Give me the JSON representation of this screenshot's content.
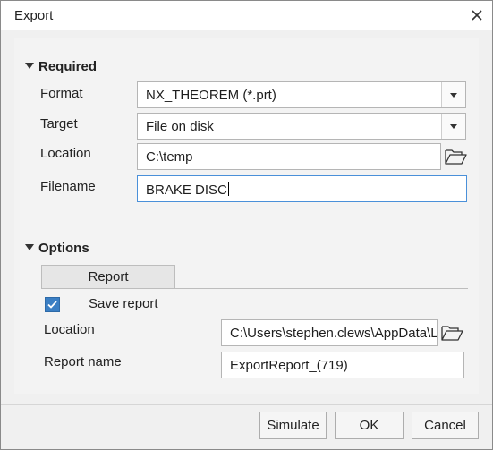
{
  "window": {
    "title": "Export"
  },
  "required": {
    "header": "Required",
    "format_label": "Format",
    "format_value": "NX_THEOREM (*.prt)",
    "target_label": "Target",
    "target_value": "File on disk",
    "location_label": "Location",
    "location_value": "C:\\temp",
    "filename_label": "Filename",
    "filename_value": "BRAKE DISC"
  },
  "options": {
    "header": "Options",
    "tab_label": "Report",
    "save_report_label": "Save report",
    "save_report_checked": true,
    "location_label": "Location",
    "location_value": "C:\\Users\\stephen.clews\\AppData\\Local\\Temp",
    "report_name_label": "Report name",
    "report_name_value": "ExportReport_(719)"
  },
  "buttons": {
    "simulate": "Simulate",
    "ok": "OK",
    "cancel": "Cancel"
  },
  "icons": {
    "close": "close-icon",
    "folder": "folder-open-icon",
    "check": "checkmark-icon",
    "dropdown": "chevron-down-icon"
  }
}
